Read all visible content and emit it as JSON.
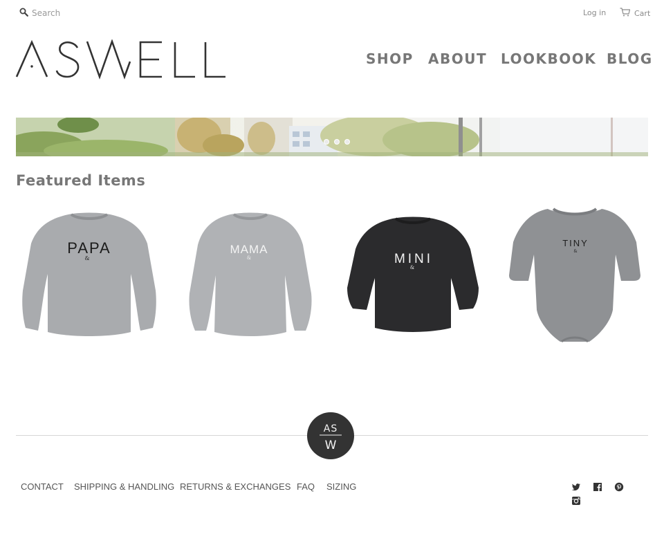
{
  "header": {
    "search_placeholder": "Search",
    "login_label": "Log in",
    "cart_label": "Cart",
    "logo_text": "ASWELL"
  },
  "nav": {
    "items": [
      {
        "label": "SHOP"
      },
      {
        "label": "ABOUT"
      },
      {
        "label": "LOOKBOOK"
      },
      {
        "label": "BLOG"
      }
    ]
  },
  "banner": {
    "slide_count": 3,
    "active_slide": 1
  },
  "featured": {
    "title": "Featured Items",
    "products": [
      {
        "print": "PAPA",
        "sub": "&",
        "garment": "light gray sweatshirt"
      },
      {
        "print": "MAMA",
        "sub": "&",
        "garment": "light gray sweatshirt"
      },
      {
        "print": "MINI",
        "sub": "&",
        "garment": "black sweatshirt"
      },
      {
        "print": "TINY",
        "sub": "&",
        "garment": "gray bodysuit"
      }
    ]
  },
  "footer": {
    "badge_text_top": "AS",
    "badge_text_bottom": "W",
    "links": [
      {
        "label": "CONTACT"
      },
      {
        "label": "SHIPPING & HANDLING"
      },
      {
        "label": "RETURNS & EXCHANGES"
      },
      {
        "label": "FAQ"
      },
      {
        "label": "SIZING"
      }
    ],
    "social": [
      "twitter-icon",
      "facebook-icon",
      "pinterest-icon",
      "instagram-icon"
    ]
  },
  "colors": {
    "text_gray": "#777777",
    "dark": "#333333",
    "footer_divider": "#d6d6d6"
  }
}
